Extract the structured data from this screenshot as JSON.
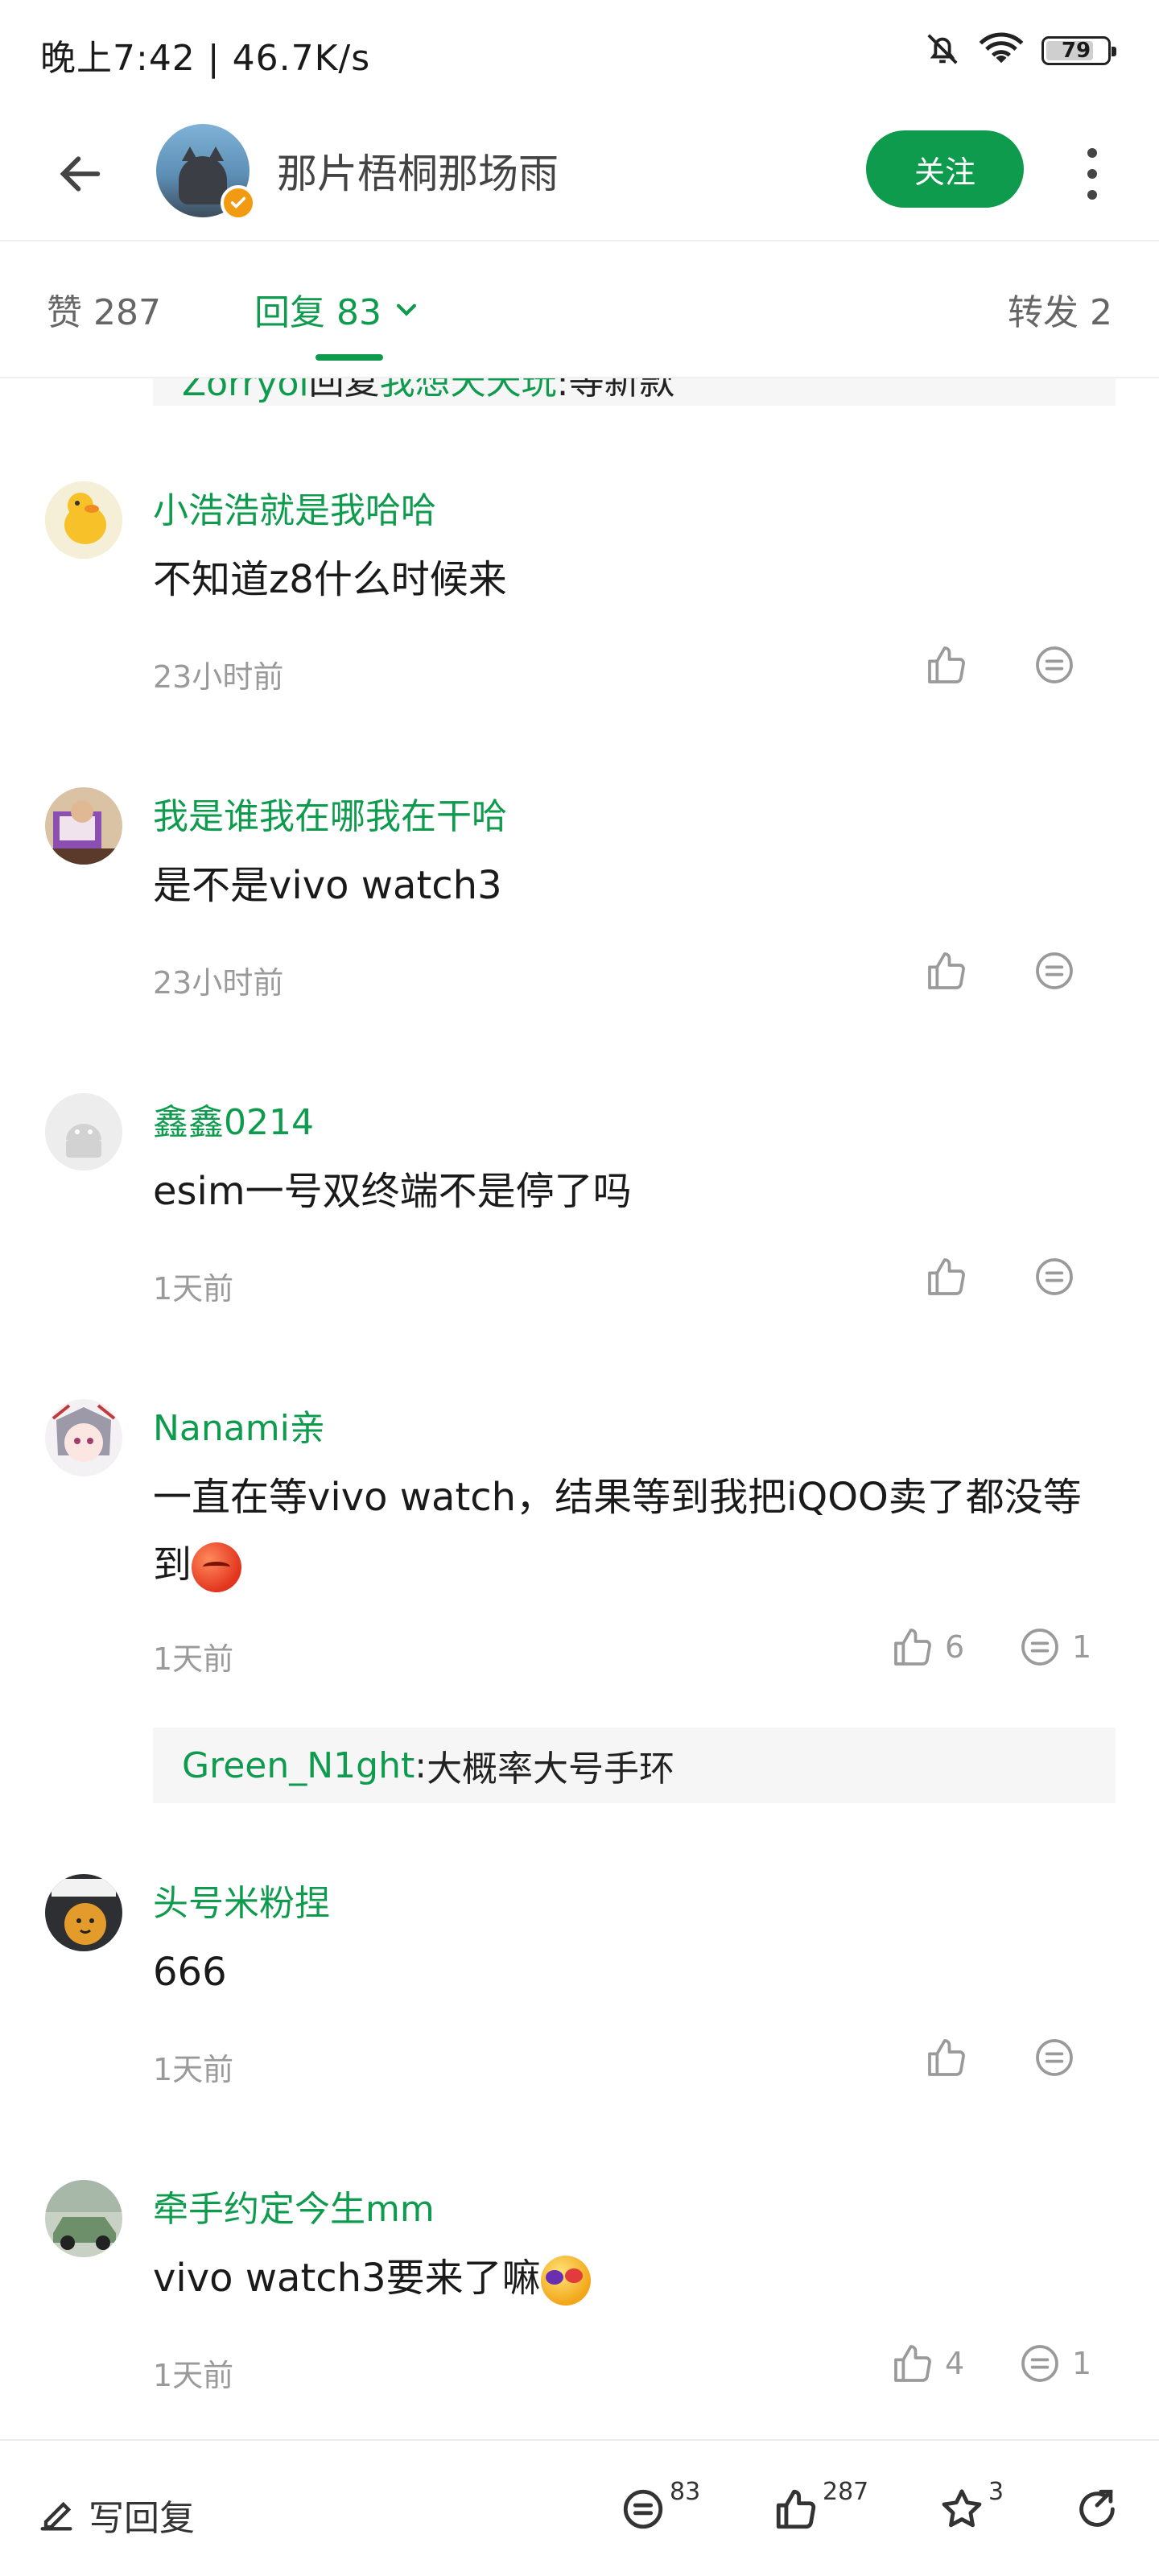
{
  "status_bar": {
    "time": "晚上7:42 | 46.7K/s",
    "battery": "79",
    "battery_level": 0.79
  },
  "header": {
    "author_name": "那片梧桐那场雨",
    "follow_label": "关注"
  },
  "tabs": {
    "likes": "赞 287",
    "replies": "回复 83",
    "forwards": "转发 2"
  },
  "partial_reply": {
    "user": "Zorryoi",
    "middle": "回复",
    "target": "我想天天玩",
    "sep": ": ",
    "text": "等新款"
  },
  "comments": [
    {
      "user": "小浩浩就是我哈哈",
      "text": "不知道z8什么时候来",
      "time": "23小时前",
      "likes": "",
      "replies": ""
    },
    {
      "user": "我是谁我在哪我在干哈",
      "text": "是不是vivo watch3",
      "time": "23小时前",
      "likes": "",
      "replies": ""
    },
    {
      "user": "鑫鑫0214",
      "text": "esim一号双终端不是停了吗",
      "time": "1天前",
      "likes": "",
      "replies": ""
    },
    {
      "user": "Nanami亲",
      "text": "一直在等vivo watch，结果等到我把iQOO卖了都没等到",
      "time": "1天前",
      "likes": "6",
      "replies": "1"
    },
    {
      "user": "头号米粉捏",
      "text": "666",
      "time": "1天前",
      "likes": "",
      "replies": ""
    },
    {
      "user": "牵手约定今生mm",
      "text": "vivo watch3要来了嘛",
      "time": "1天前",
      "likes": "4",
      "replies": "1"
    }
  ],
  "nested_reply": {
    "user": "Green_N1ght",
    "sep": ": ",
    "text": "大概率大号手环"
  },
  "bottom_bar": {
    "write_reply": "写回复",
    "comment_count": "83",
    "like_count": "287",
    "star_count": "3"
  },
  "colors": {
    "accent": "#0f9b4e",
    "muted": "#9a9a9a",
    "badge": "#f29a12"
  },
  "icons": [
    "back-arrow-icon",
    "verified-badge-icon",
    "more-vertical-icon",
    "chevron-down-icon",
    "thumb-up-icon",
    "comment-icon",
    "pencil-icon",
    "star-icon",
    "share-icon",
    "bell-off-icon",
    "wifi-icon",
    "battery-icon"
  ]
}
